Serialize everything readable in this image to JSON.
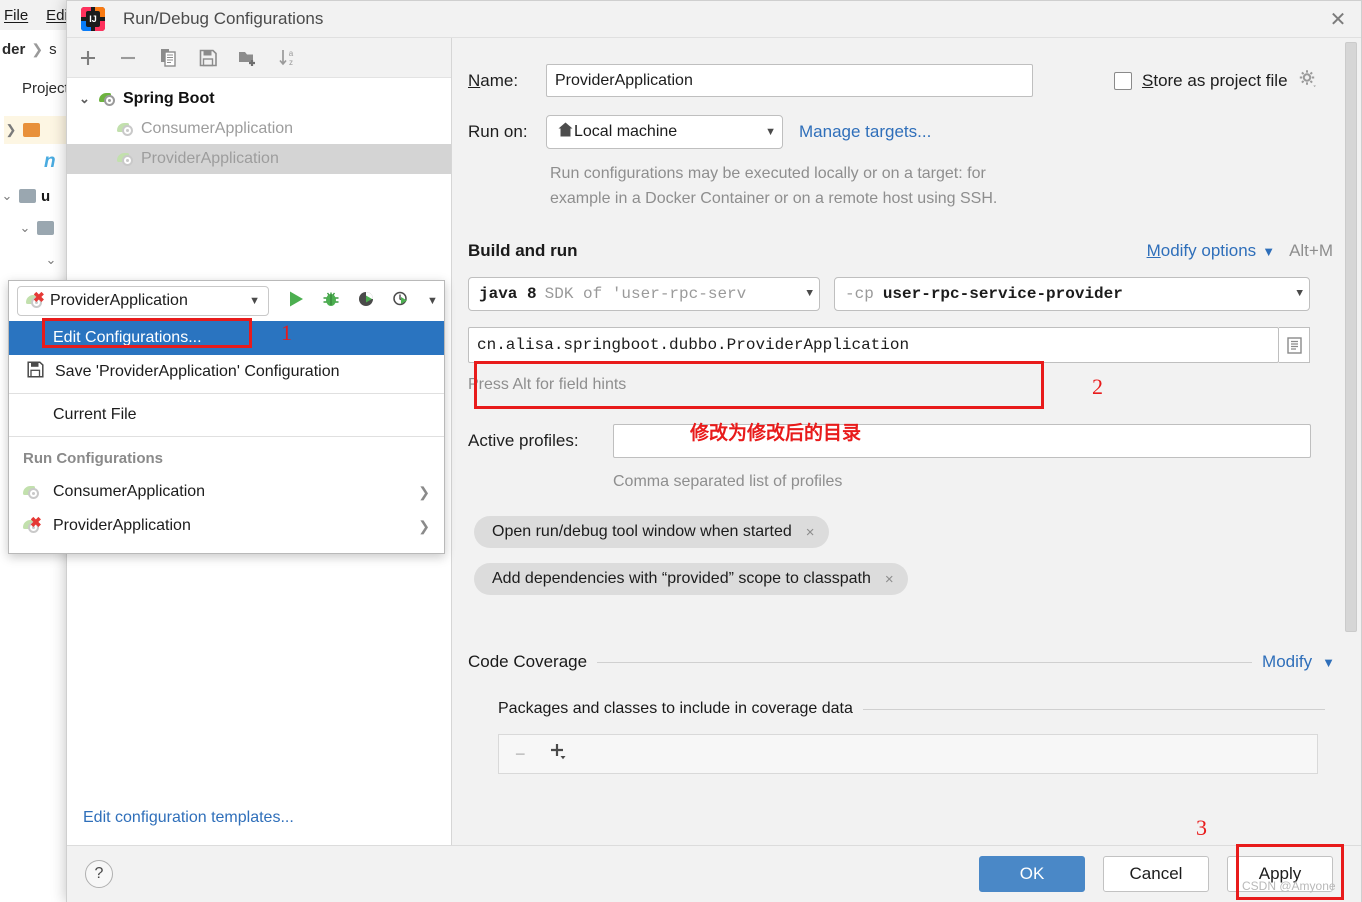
{
  "ide": {
    "menu": [
      "File",
      "Edit"
    ],
    "breadcrumb": [
      "der",
      "s"
    ],
    "project_tab": "Project",
    "tree_nodes": [
      "",
      "n",
      "u",
      "",
      ""
    ]
  },
  "dialog": {
    "title": "Run/Debug Configurations",
    "close_icon": "close-icon",
    "logo_icon": "intellij-idea-logo"
  },
  "left_panel": {
    "toolbar": [
      {
        "name": "add-configuration-button",
        "glyph": "+"
      },
      {
        "name": "remove-configuration-button",
        "glyph": "−"
      },
      {
        "name": "copy-configuration-button",
        "glyph": "copy-icon"
      },
      {
        "name": "save-configuration-button",
        "glyph": "save-icon"
      },
      {
        "name": "new-folder-button",
        "glyph": "folder-plus-icon"
      },
      {
        "name": "sort-configurations-button",
        "glyph": "sort-alpha-icon"
      }
    ],
    "tree": {
      "group_label": "Spring Boot",
      "children": [
        {
          "label": "ConsumerApplication",
          "selected": false
        },
        {
          "label": "ProviderApplication",
          "selected": true
        }
      ]
    },
    "footer_link": "Edit configuration templates..."
  },
  "form": {
    "name_label": "Name:",
    "name_label_mnemonic": "N",
    "name_value": "ProviderApplication",
    "store_as_project_file_label": "Store as project file",
    "store_as_project_file_mnemonic": "S",
    "store_as_project_file_checked": false,
    "gear_icon": "gear-icon",
    "run_on_label": "Run on:",
    "run_on_value": "Local machine",
    "run_on_icon": "home-icon",
    "manage_targets_link": "Manage targets...",
    "run_on_hint_line1": "Run configurations may be executed locally or on a target: for",
    "run_on_hint_line2": "example in a Docker Container or on a remote host using SSH.",
    "build_and_run_title": "Build and run",
    "modify_options_label": "Modify options",
    "modify_options_mnemonic": "M",
    "modify_options_shortcut": "Alt+M",
    "jdk_value_bold": "java 8",
    "jdk_value_gray": "SDK of 'user-rpc-serv",
    "classpath_prefix": "-cp",
    "classpath_value": "user-rpc-service-provider",
    "main_class_value": "cn.alisa.springboot.dubbo.ProviderApplication",
    "main_class_browse_icon": "class-browse-icon",
    "field_hints": "Press Alt for field hints",
    "active_profiles_label": "Active profiles:",
    "active_profiles_value": "",
    "active_profiles_hint": "Comma separated list of profiles",
    "option_pills": [
      {
        "label": "Open run/debug tool window when started",
        "close": "×"
      },
      {
        "label": "Add dependencies with “provided” scope to classpath",
        "close": "×"
      }
    ],
    "code_coverage_title": "Code Coverage",
    "code_coverage_modify": "Modify",
    "coverage_packages_title": "Packages and classes to include in coverage data",
    "coverage_remove_glyph": "−",
    "coverage_add_glyph": "+"
  },
  "buttons": {
    "help": "?",
    "ok": "OK",
    "cancel": "Cancel",
    "apply": "Apply"
  },
  "run_popup": {
    "combo_label": "ProviderApplication",
    "run_icons": [
      {
        "name": "run-icon",
        "glyph": "▶"
      },
      {
        "name": "debug-icon",
        "glyph": "bug"
      },
      {
        "name": "run-with-coverage-icon",
        "glyph": "coverage"
      },
      {
        "name": "profile-icon",
        "glyph": "profiler"
      },
      {
        "name": "more-runners-dropdown-icon",
        "glyph": "▾"
      }
    ],
    "items": [
      {
        "label": "Edit Configurations...",
        "highlighted": true,
        "icon": null,
        "submenu": false
      },
      {
        "label": "Save 'ProviderApplication' Configuration",
        "highlighted": false,
        "icon": "save-icon",
        "submenu": false
      },
      {
        "label": "Current File",
        "highlighted": false,
        "icon": null,
        "submenu": false
      }
    ],
    "section_header": "Run Configurations",
    "configs": [
      {
        "label": "ConsumerApplication",
        "error": false
      },
      {
        "label": "ProviderApplication",
        "error": true
      }
    ]
  },
  "annotations": {
    "num1": "1",
    "num2": "2",
    "num3": "3",
    "chinese_note": "修改为修改后的目录",
    "watermark": "CSDN @Amyone",
    "highlight_color": "#e81b1b"
  }
}
